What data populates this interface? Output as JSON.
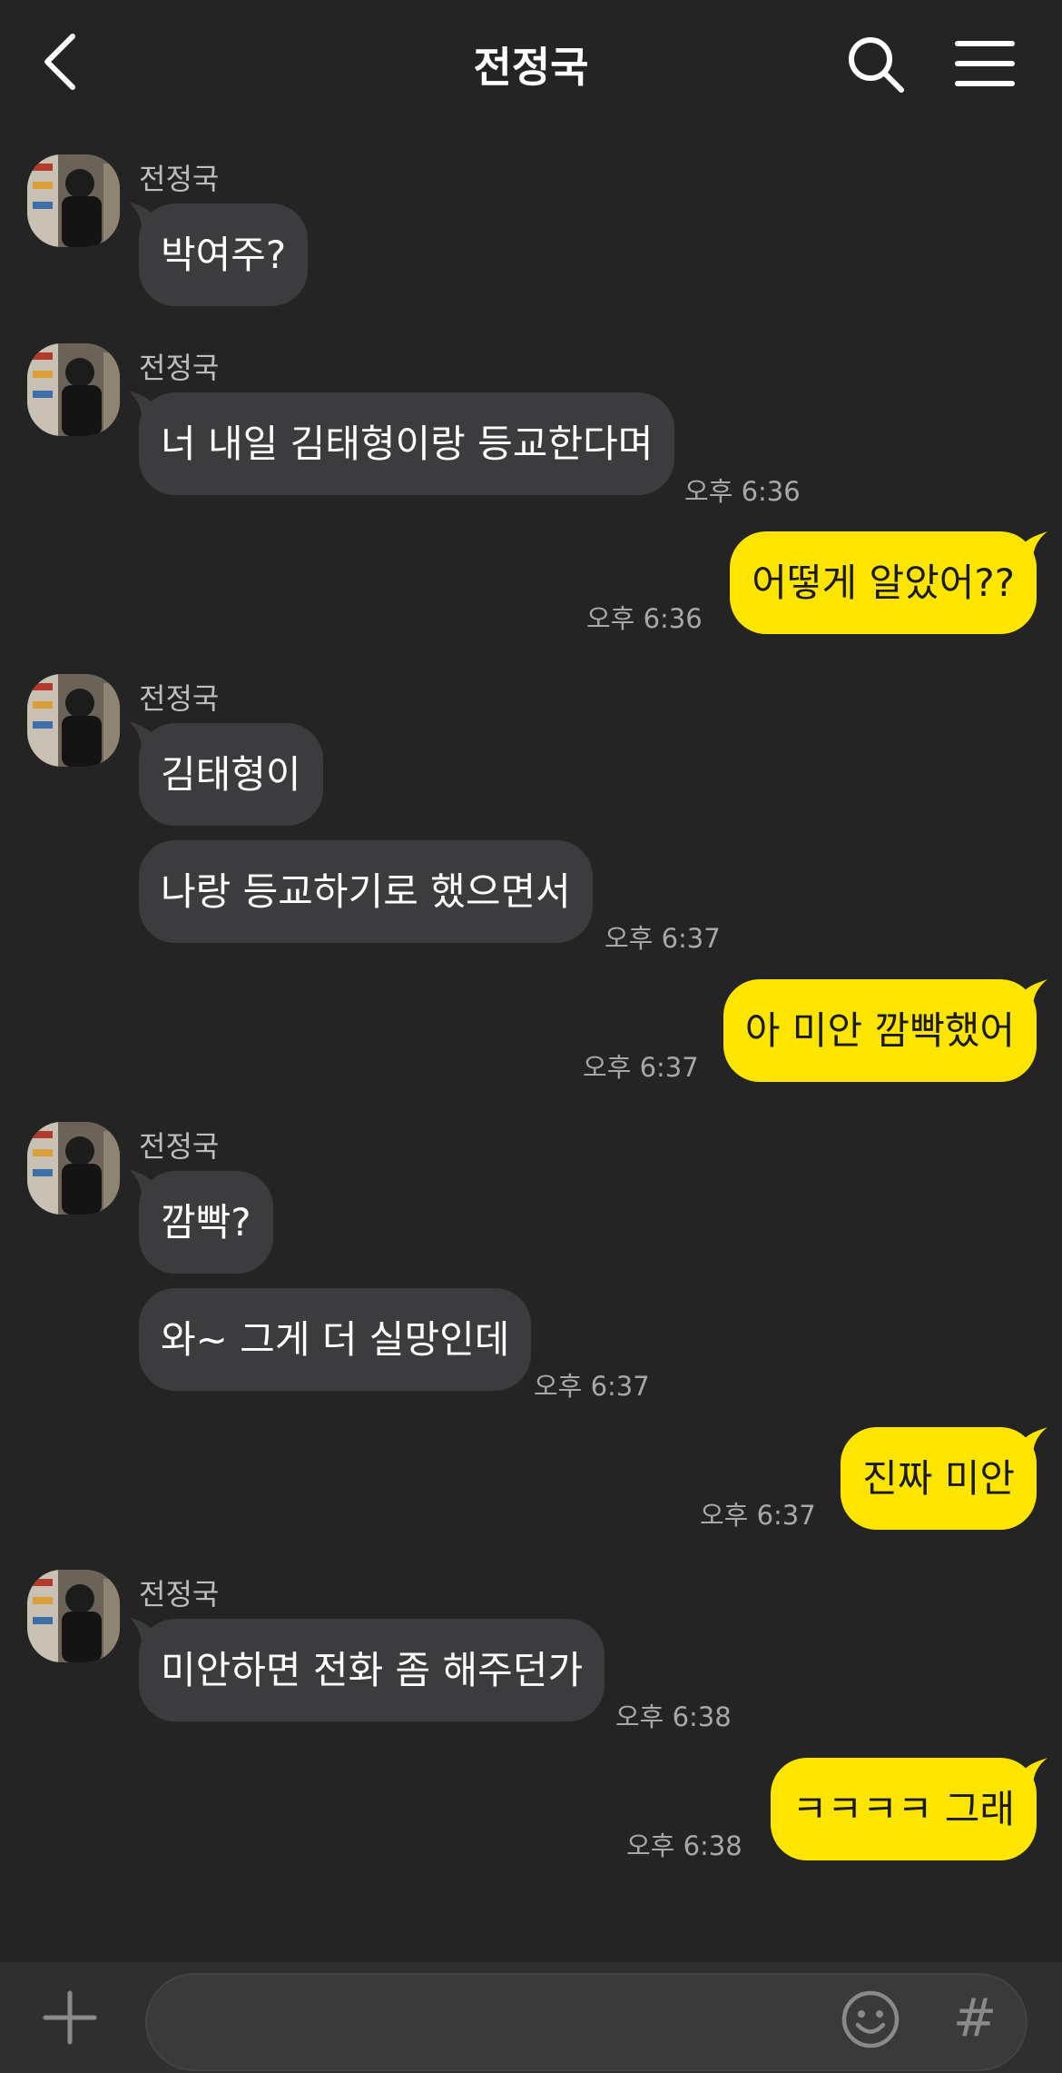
{
  "header": {
    "title": "전정국"
  },
  "contact": {
    "name": "전정국"
  },
  "messages": [
    {
      "side": "in",
      "text": "박여주?",
      "time": ""
    },
    {
      "side": "in",
      "text": "너 내일 김태형이랑 등교한다며",
      "time": "오후 6:36"
    },
    {
      "side": "out",
      "text": "어떻게 알았어??",
      "time": "오후 6:36"
    },
    {
      "side": "in",
      "text": "김태형이",
      "time": ""
    },
    {
      "side": "in",
      "text": "나랑 등교하기로 했으면서",
      "time": "오후 6:37"
    },
    {
      "side": "out",
      "text": "아 미안 깜빡했어",
      "time": "오후 6:37"
    },
    {
      "side": "in",
      "text": "깜빡?",
      "time": ""
    },
    {
      "side": "in",
      "text": "와~ 그게 더 실망인데",
      "time": "오후 6:37"
    },
    {
      "side": "out",
      "text": "진짜 미안",
      "time": "오후 6:37"
    },
    {
      "side": "in",
      "text": "미안하면 전화 좀 해주던가",
      "time": "오후 6:38"
    },
    {
      "side": "out",
      "text": "ㅋㅋㅋㅋ 그래",
      "time": "오후 6:38"
    }
  ],
  "input": {
    "value": "",
    "placeholder": ""
  },
  "icons": {
    "back": "chevron-left-icon",
    "search": "search-icon",
    "menu": "hamburger-menu-icon",
    "plus": "plus-icon",
    "emoji": "smiley-icon",
    "hash": "#"
  },
  "colors": {
    "background": "#242424",
    "incoming_bubble": "#3c3c3e",
    "outgoing_bubble": "#fde500"
  }
}
